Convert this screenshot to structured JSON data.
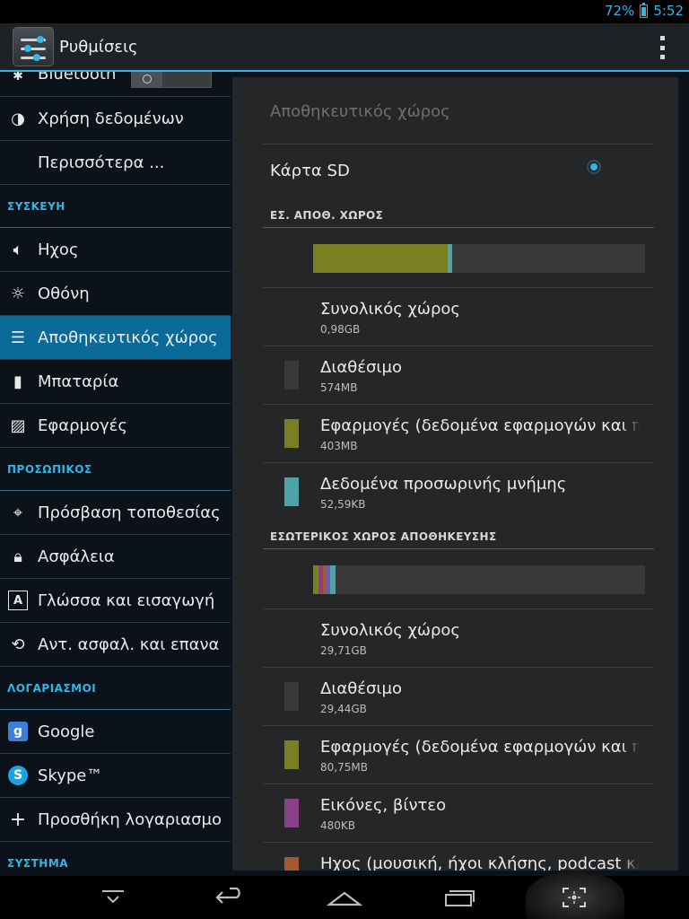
{
  "status": {
    "battery_percent": "72%",
    "time": "5:52",
    "accent": "#33b5e5"
  },
  "app": {
    "title": "Ρυθμίσεις",
    "icon": "settings-app-icon",
    "overflow_icon": "overflow-menu-icon"
  },
  "sidebar": {
    "items_top": [
      {
        "label": "Bluetooth",
        "icon": "bluetooth-icon"
      },
      {
        "label": "Χρήση δεδομένων",
        "icon": "data-usage-icon"
      },
      {
        "label": "Περισσότερα ...",
        "icon": ""
      }
    ],
    "section_device": "ΣΥΣΚΕΥΗ",
    "items_device": [
      {
        "label": "Ηχος",
        "icon": "sound-icon"
      },
      {
        "label": "Οθόνη",
        "icon": "display-icon"
      },
      {
        "label": "Αποθηκευτικός χώρος",
        "icon": "storage-icon"
      },
      {
        "label": "Μπαταρία",
        "icon": "battery-icon"
      },
      {
        "label": "Εφαρμογές",
        "icon": "apps-icon"
      }
    ],
    "section_personal": "ΠΡΟΣΩΠΙΚΟΣ",
    "items_personal": [
      {
        "label": "Πρόσβαση τοποθεσίας",
        "icon": "location-icon"
      },
      {
        "label": "Ασφάλεια",
        "icon": "lock-icon"
      },
      {
        "label": "Γλώσσα και εισαγωγή",
        "icon": "language-icon"
      },
      {
        "label": "Αντ. ασφαλ. και επανα",
        "icon": "backup-icon"
      }
    ],
    "section_accounts": "ΛΟΓΑΡΙΑΣΜΟΙ",
    "items_accounts": [
      {
        "label": "Google",
        "icon": "google-icon"
      },
      {
        "label": "Skype™",
        "icon": "skype-icon"
      },
      {
        "label": "Προσθήκη λογαριασμο",
        "icon": "add-icon"
      }
    ],
    "section_system": "ΣΥΣΤΗΜΑ",
    "selected": "Αποθηκευτικός χώρος"
  },
  "storage": {
    "title": "Αποθηκευτικός χώρος",
    "sd_card_label": "Κάρτα SD",
    "sd_card_selected": true,
    "external": {
      "header": "ΕΣ. ΑΠΟΘ. ΧΩΡΟΣ",
      "usage_fractions": [
        {
          "color": "#7a7f23",
          "fraction": 0.405
        },
        {
          "color": "#4fa3a6",
          "fraction": 0.015
        }
      ],
      "rows": [
        {
          "title": "Συνολικός χώρος",
          "value": "0,98GB",
          "color": ""
        },
        {
          "title": "Διαθέσιμο",
          "value": "574MB",
          "color": "#3a3a3b"
        },
        {
          "title": "Εφαρμογές (δεδομένα εφαρμογών και π",
          "value": "403MB",
          "color": "#7a7f23"
        },
        {
          "title": "Δεδομένα προσωρινής μνήμης",
          "value": "52,59KB",
          "color": "#4fa3a6"
        }
      ]
    },
    "internal": {
      "header": "ΕΣΩΤΕΡΙΚΟΣ ΧΩΡΟΣ ΑΠΟΘΗΚΕΥΣΗΣ",
      "usage_fractions": [
        {
          "color": "#7a7f23",
          "fraction": 0.016
        },
        {
          "color": "#8a3f8a",
          "fraction": 0.013
        },
        {
          "color": "#a5582c",
          "fraction": 0.012
        },
        {
          "color": "#6a5ab0",
          "fraction": 0.01
        },
        {
          "color": "#4fa3a6",
          "fraction": 0.016
        }
      ],
      "rows": [
        {
          "title": "Συνολικός χώρος",
          "value": "29,71GB",
          "color": ""
        },
        {
          "title": "Διαθέσιμο",
          "value": "29,44GB",
          "color": "#3a3a3b"
        },
        {
          "title": "Εφαρμογές (δεδομένα εφαρμογών και π",
          "value": "80,75MB",
          "color": "#7a7f23"
        },
        {
          "title": "Εικόνες, βίντεο",
          "value": "480KB",
          "color": "#8a3f8a"
        },
        {
          "title": "Ηχος (μουσική, ήχοι κλήσης, podcast κλ",
          "value": "",
          "color": "#a5582c"
        }
      ]
    }
  },
  "navbar": {
    "buttons": [
      "hide-keyboard-icon",
      "back-icon",
      "home-icon",
      "recent-apps-icon",
      "screenshot-icon"
    ]
  }
}
